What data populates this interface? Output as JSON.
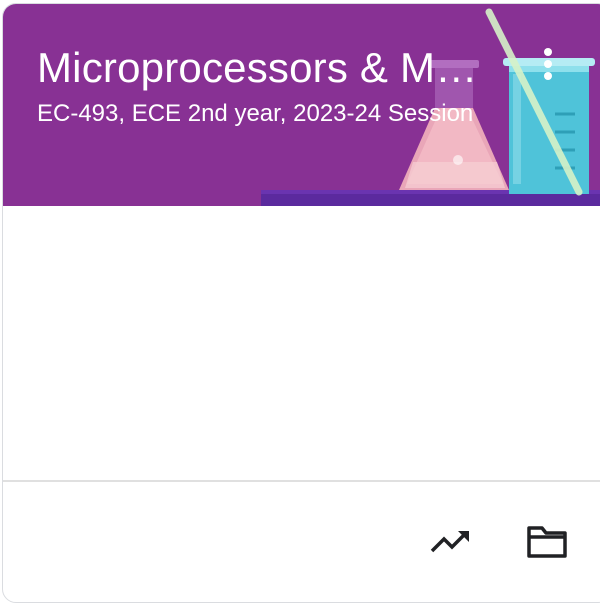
{
  "course": {
    "title": "Microprocessors & M…",
    "subtitle": "EC-493, ECE 2nd year, 2023-24 Session"
  },
  "header": {
    "theme_color": "#883194",
    "illustration": "science-lab-flask-beaker"
  },
  "actions": {
    "more_icon": "more-vert-icon",
    "trending_icon": "trending-up-icon",
    "folder_icon": "folder-icon"
  }
}
